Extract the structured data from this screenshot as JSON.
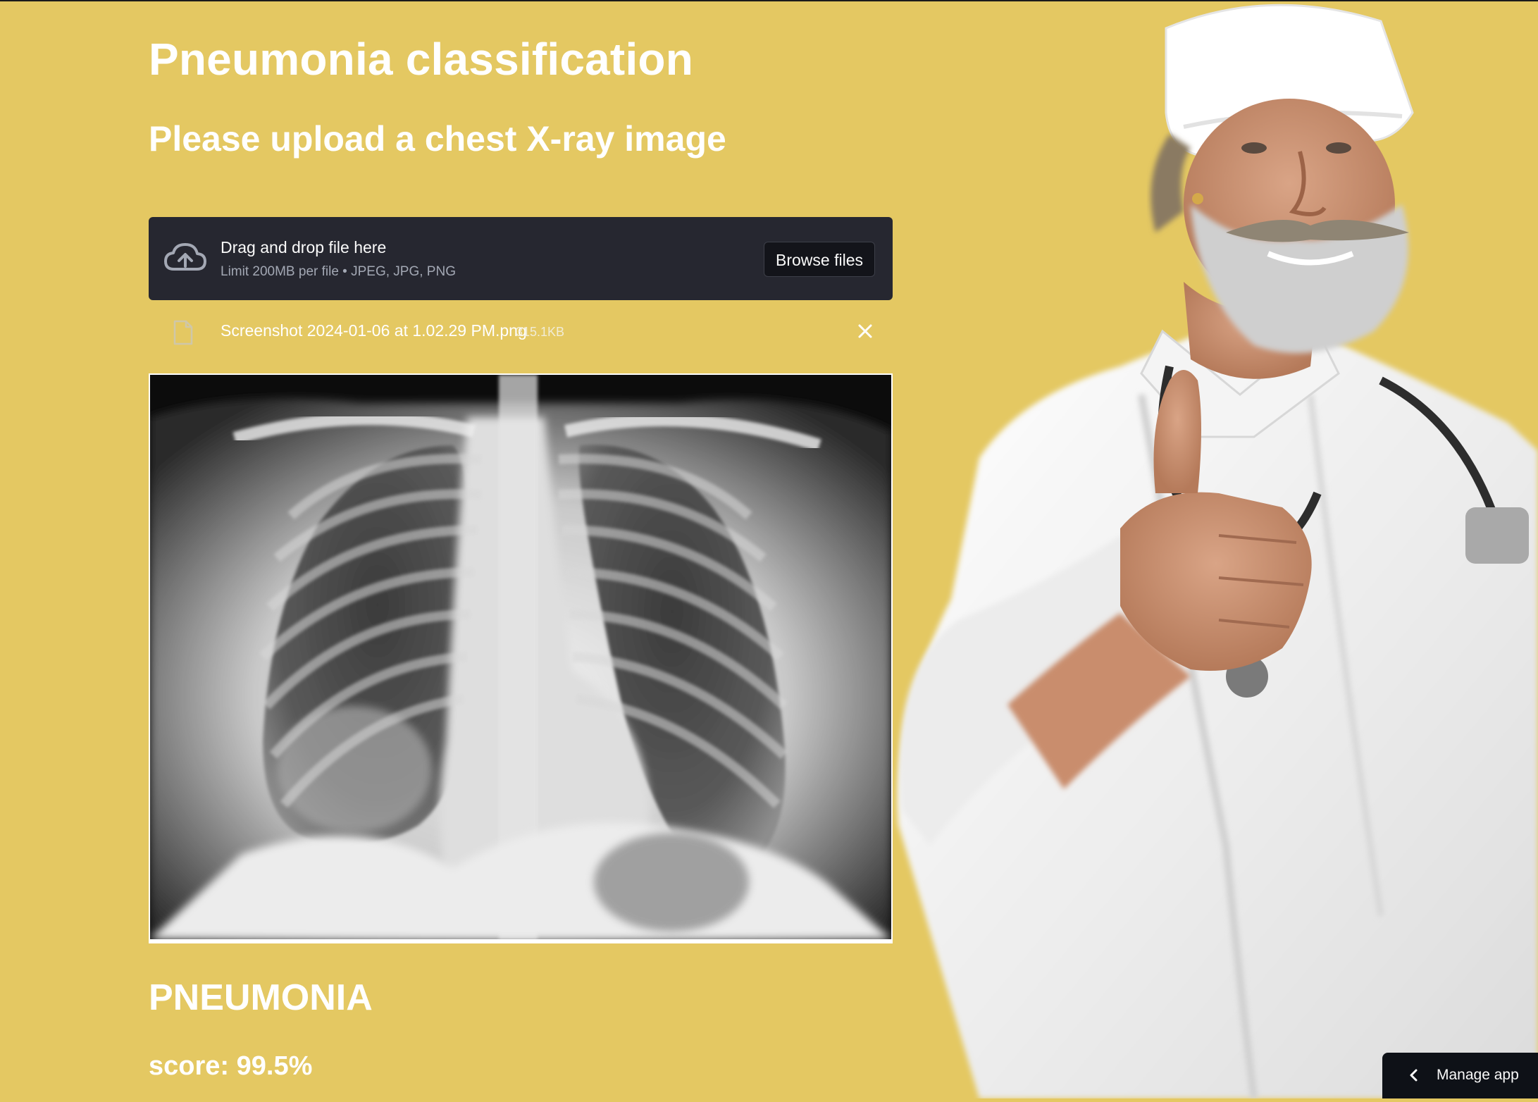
{
  "app": {
    "title": "Pneumonia classification",
    "subtitle": "Please upload a chest X-ray image"
  },
  "uploader": {
    "drop_title": "Drag and drop file here",
    "limit_text": "Limit 200MB per file • JPEG, JPG, PNG",
    "browse_label": "Browse files",
    "icon": "cloud-upload-icon"
  },
  "file": {
    "name": "Screenshot 2024-01-06 at 1.02.29 PM.png",
    "size": "315.1KB",
    "icon": "file-icon",
    "remove_icon": "close-icon"
  },
  "prediction": {
    "label": "PNEUMONIA",
    "score_text": "score: 99.5%"
  },
  "footer": {
    "manage_label": "Manage app",
    "icon": "chevron-left-icon"
  },
  "colors": {
    "background": "#e4c862",
    "uploader_bg": "#262730",
    "text": "#ffffff"
  }
}
